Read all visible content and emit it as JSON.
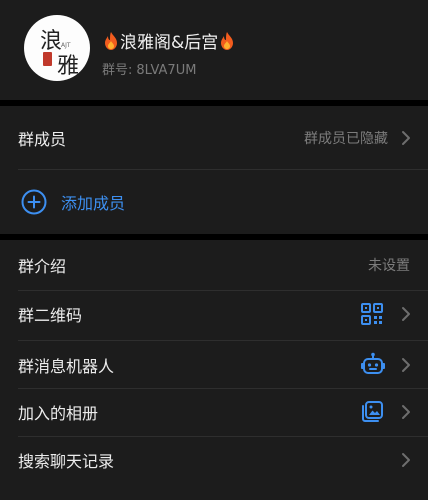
{
  "header": {
    "group_name": "浪雅阁&后宫",
    "group_id_label": "群号:",
    "group_id_value": "8LVA7UM",
    "avatar_text_1": "浪",
    "avatar_text_2": "雅",
    "avatar_mark": "AJT"
  },
  "members": {
    "label": "群成员",
    "status": "群成员已隐藏",
    "add_label": "添加成员"
  },
  "info": {
    "intro_label": "群介绍",
    "intro_value": "未设置",
    "qr_label": "群二维码",
    "bot_label": "群消息机器人",
    "album_label": "加入的相册",
    "search_label": "搜索聊天记录"
  },
  "colors": {
    "accent": "#3d8ff0",
    "background": "#000000",
    "card": "#1c1c1c"
  },
  "icons": [
    "flame-icon",
    "chevron-right-icon",
    "plus-circle-icon",
    "qr-code-icon",
    "robot-icon",
    "album-icon"
  ]
}
